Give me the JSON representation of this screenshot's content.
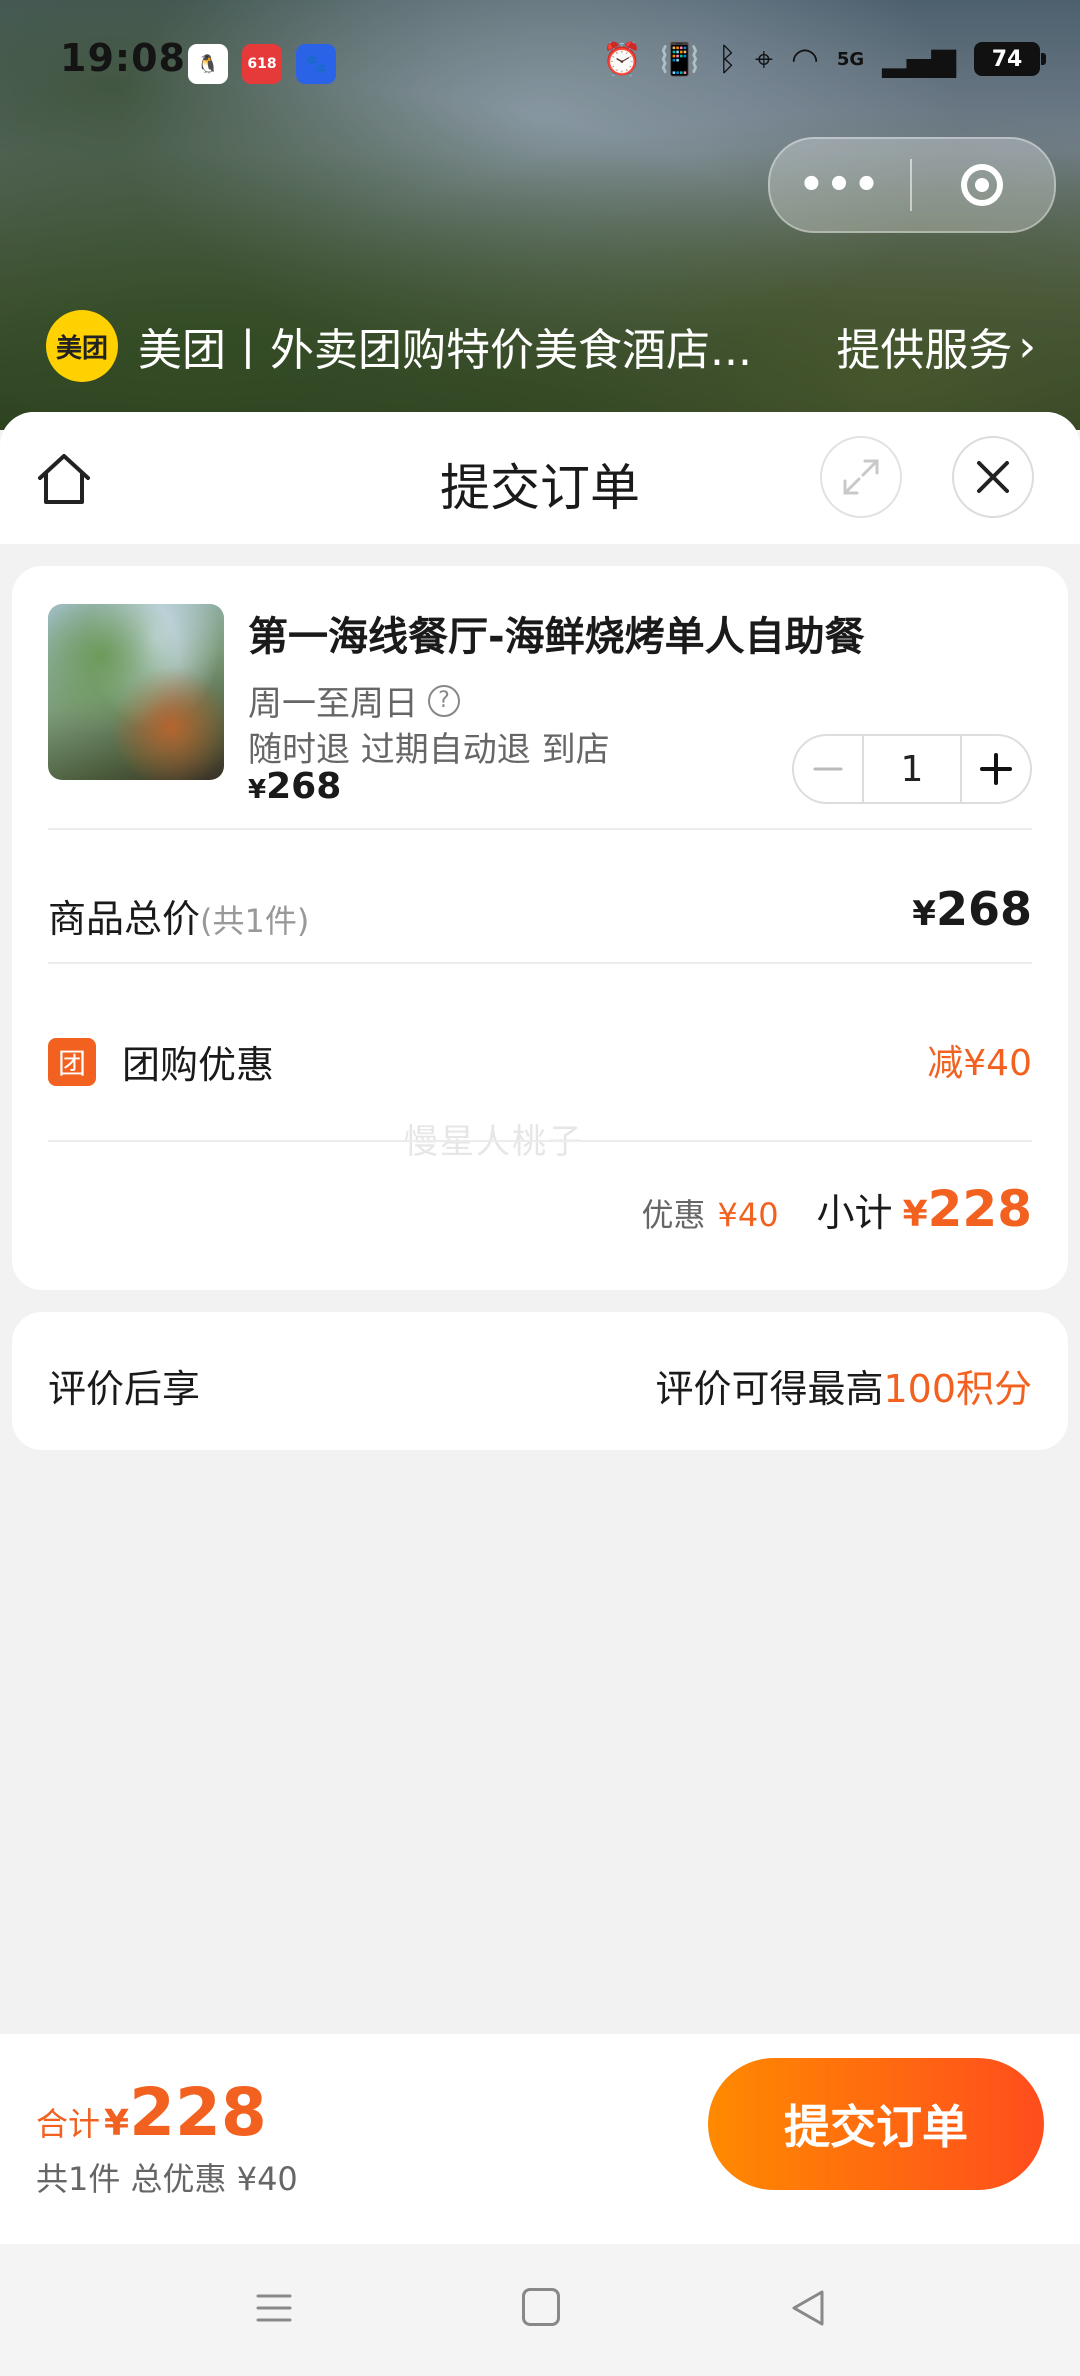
{
  "status_bar": {
    "time": "19:08",
    "notification_icons": [
      "qq-icon",
      "shopping-app-icon",
      "baidu-icon"
    ],
    "network": "5G",
    "battery": "74"
  },
  "mini_program": {
    "logo_text": "美团",
    "name": "美团丨外卖团购特价美食酒店...",
    "service_label": "提供服务"
  },
  "sheet": {
    "title": "提交订单"
  },
  "product": {
    "title": "第一海线餐厅-海鲜烧烤单人自助餐",
    "schedule": "周一至周日",
    "help_glyph": "?",
    "policy": "随时退 过期自动退 到店",
    "price_currency": "¥",
    "price": "268",
    "quantity": "1"
  },
  "summary": {
    "goods_total_label": "商品总价",
    "goods_count": "(共1件)",
    "goods_total_currency": "¥",
    "goods_total": "268",
    "group_badge": "团",
    "group_discount_label": "团购优惠",
    "group_discount_value": "减¥40",
    "watermark": "慢星人桃子",
    "saving_label": "优惠",
    "saving_value": "¥40",
    "subtotal_label": "小计",
    "subtotal_currency": "¥",
    "subtotal_value": "228"
  },
  "review": {
    "label": "评价后享",
    "prefix": "评价可得最高",
    "points": "100积分"
  },
  "bottom": {
    "total_label": "合计",
    "total_currency": "¥",
    "total_value": "228",
    "total_sub": "共1件 总优惠 ¥40",
    "submit_label": "提交订单"
  },
  "colors": {
    "accent": "#f2611f",
    "button_gradient_start": "#ff8a00",
    "button_gradient_end": "#ff4d1d",
    "brand_yellow": "#ffd100"
  }
}
